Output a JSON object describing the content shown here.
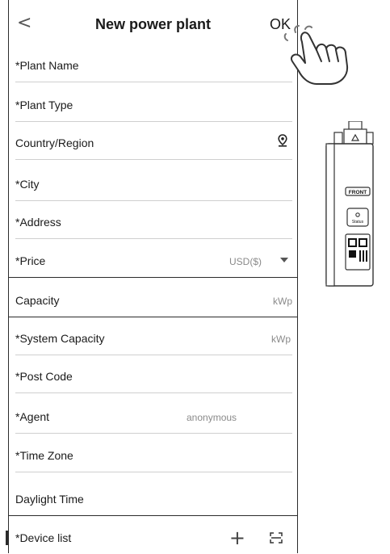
{
  "header": {
    "back_glyph": "<",
    "title": "New power plant",
    "ok_label": "OK"
  },
  "fields": {
    "plant_name": "*Plant Name",
    "plant_type": "*Plant Type",
    "country_region": "Country/Region",
    "city": "*City",
    "address": "*Address",
    "price": "*Price",
    "price_currency": "USD($)",
    "capacity": "Capacity",
    "capacity_unit": "kWp",
    "system_capacity": "*System Capacity",
    "system_capacity_unit": "kWp",
    "post_code": "*Post Code",
    "agent": "*Agent",
    "agent_value": "anonymous",
    "time_zone": "*Time Zone",
    "daylight_time": "Daylight Time",
    "device_list": "*Device list"
  },
  "icons": {
    "back": "chevron-left-icon",
    "location": "location-pin-icon",
    "dropdown": "caret-down-icon",
    "add": "plus-icon",
    "scan": "scan-icon",
    "pointer": "hand-pointer-icon"
  },
  "device_label": {
    "front": "FRONT",
    "status": "Status"
  }
}
